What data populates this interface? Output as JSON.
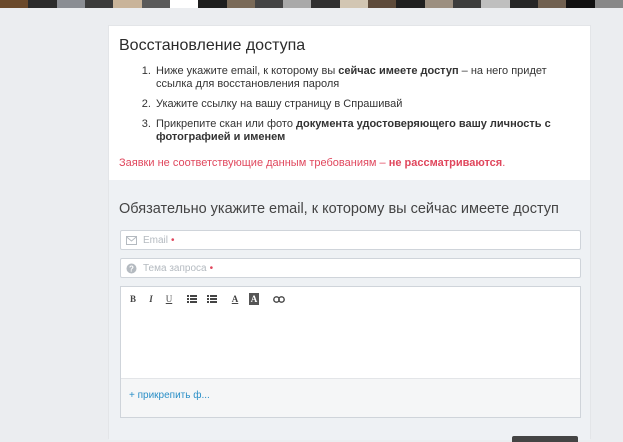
{
  "photo_strip": {
    "colors": [
      "#6b4a2c",
      "#2b2b2b",
      "#8a8d93",
      "#3b3b3b",
      "#c9b49a",
      "#5a5a5a",
      "#ffffff",
      "#1e1e1e",
      "#7a6a58",
      "#444444",
      "#a9a9a9",
      "#303030",
      "#d2c6b3",
      "#5e4b3b",
      "#202020",
      "#9c8f80",
      "#3d3d3d",
      "#bfbfbf",
      "#262626",
      "#706050",
      "#111111",
      "#888888"
    ]
  },
  "recovery": {
    "title": "Восстановление доступа",
    "steps": [
      {
        "pre": "Ниже укажите email, к которому вы ",
        "bold": "сейчас имеете доступ",
        "post": " – на него придет ссылка для восстановления пароля"
      },
      {
        "pre": "Укажите ссылку на вашу страницу в Спрашивай",
        "bold": "",
        "post": ""
      },
      {
        "pre": "Прикрепите скан или фото ",
        "bold": "документа удостоверяющего вашу личность с фотографией и именем",
        "post": ""
      }
    ],
    "warning_pre": "Заявки не соответствующие данным требованиям – ",
    "warning_bold": "не рассматриваются",
    "warning_post": "."
  },
  "form": {
    "title": "Обязательно укажите email, к которому вы сейчас имеете доступ",
    "email_placeholder": "Email",
    "topic_placeholder": "Тема запроса",
    "required_mark": "•",
    "toolbar": {
      "bold": "B",
      "italic": "I",
      "underline": "U",
      "font_color": "A",
      "bg_color": "A"
    },
    "attach_label": "+ прикрепить ф..."
  },
  "colors": {
    "accent_link": "#2a8fc7",
    "warning": "#e0475d",
    "form_bg": "#eef1f4"
  }
}
